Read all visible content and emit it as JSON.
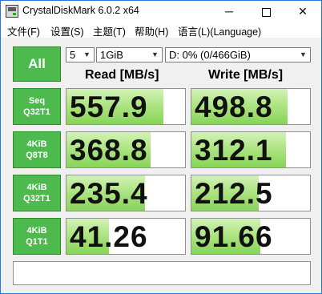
{
  "window": {
    "title": "CrystalDiskMark 6.0.2 x64",
    "minimize": "─",
    "close": "✕"
  },
  "menu": {
    "file": "文件(F)",
    "settings": "设置(S)",
    "theme": "主题(T)",
    "help": "帮助(H)",
    "language": "语言(L)(Language)"
  },
  "controls": {
    "all_label": "All",
    "count": "5",
    "size": "1GiB",
    "drive": "D: 0% (0/466GiB)"
  },
  "headers": {
    "read": "Read [MB/s]",
    "write": "Write [MB/s]"
  },
  "tests": [
    {
      "line1": "Seq",
      "line2": "Q32T1",
      "read": "557.9",
      "write": "498.8",
      "read_fill_pct": 82,
      "write_fill_pct": 81
    },
    {
      "line1": "4KiB",
      "line2": "Q8T8",
      "read": "368.8",
      "write": "312.1",
      "read_fill_pct": 71,
      "write_fill_pct": 80
    },
    {
      "line1": "4KiB",
      "line2": "Q32T1",
      "read": "235.4",
      "write": "212.5",
      "read_fill_pct": 66,
      "write_fill_pct": 57
    },
    {
      "line1": "4KiB",
      "line2": "Q1T1",
      "read": "41.26",
      "write": "91.66",
      "read_fill_pct": 36,
      "write_fill_pct": 58
    }
  ],
  "comment": "",
  "colors": {
    "accent_green": "#4dba4d",
    "bar_green": "#9bdc6b",
    "window_border": "#2b79d7"
  }
}
